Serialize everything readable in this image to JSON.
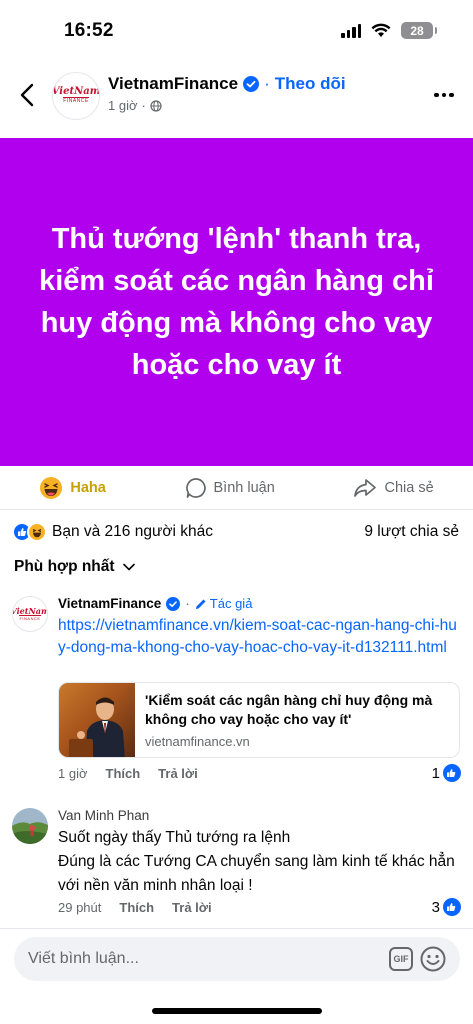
{
  "status_bar": {
    "time": "16:52",
    "battery": "28"
  },
  "header": {
    "page_name": "VietnamFinance",
    "follow_label": "Theo dõi",
    "separator": "·",
    "time_ago": "1 giờ",
    "logo_top": "VietNam",
    "logo_bottom": "FINANCE"
  },
  "post": {
    "text": "Thủ tướng 'lệnh' thanh tra, kiểm soát các ngân hàng chỉ huy động mà không cho vay hoặc cho vay ít",
    "background": "#b100ee"
  },
  "actions": {
    "haha_label": "Haha",
    "comment_label": "Bình luận",
    "share_label": "Chia sẻ"
  },
  "stats": {
    "reactions_text": "Bạn và 216 người khác",
    "shares_text": "9 lượt chia sẻ"
  },
  "sort": {
    "label": "Phù hợp nhất"
  },
  "comments": [
    {
      "author": "VietnamFinance",
      "author_tag": "Tác giả",
      "link": "https://vietnamfinance.vn/kiem-soat-cac-ngan-hang-chi-huy-dong-ma-khong-cho-vay-hoac-cho-vay-it-d132111.html",
      "preview_title": "'Kiểm soát các ngân hàng chỉ huy động mà không cho vay hoặc cho vay ít'",
      "preview_domain": "vietnamfinance.vn",
      "time": "1 giờ",
      "like_label": "Thích",
      "reply_label": "Trả lời",
      "likes": "1"
    },
    {
      "author": "Van Minh Phan",
      "text_line1": "Suốt ngày thấy Thủ tướng ra lệnh",
      "text_line2": "Đúng là các Tướng CA chuyển sang làm kinh tế khác hẳn với nền văn minh nhân loại !",
      "time": "29 phút",
      "like_label": "Thích",
      "reply_label": "Trả lời",
      "likes": "3"
    }
  ],
  "composer": {
    "placeholder": "Viết bình luận...",
    "gif_label": "GIF"
  },
  "colors": {
    "accent": "#0866ff",
    "muted": "#65676b",
    "haha": "#f7b125"
  }
}
